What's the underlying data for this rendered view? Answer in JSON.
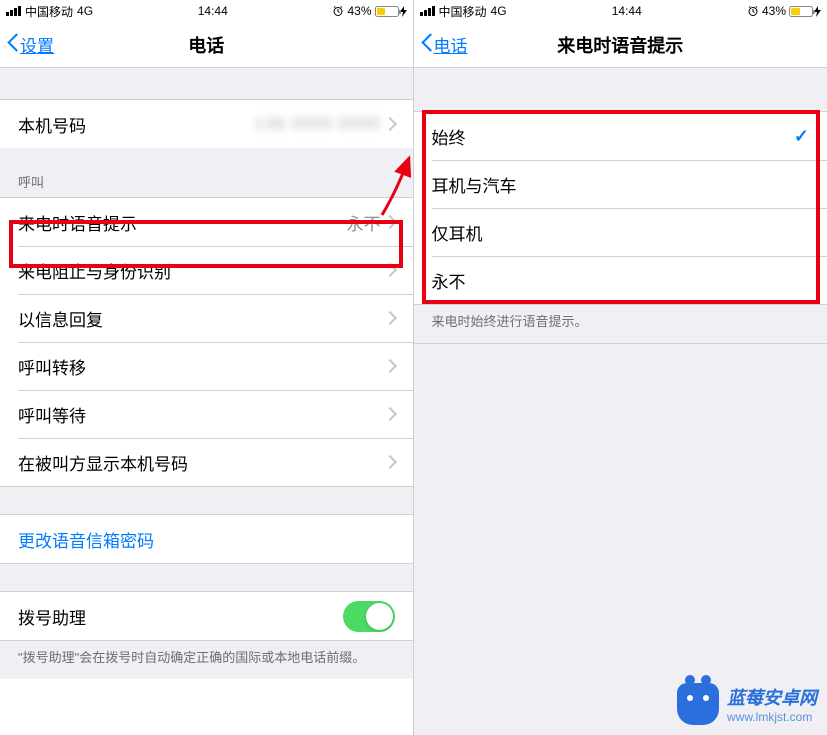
{
  "status": {
    "carrier": "中国移动",
    "network": "4G",
    "time": "14:44",
    "battery_pct": "43%"
  },
  "left": {
    "back_label": "设置",
    "title": "电话",
    "my_number_label": "本机号码",
    "my_number_value": "",
    "call_section_header": "呼叫",
    "announce_label": "来电时语音提示",
    "announce_value": "永不",
    "block_id_label": "来电阻止与身份识别",
    "respond_text_label": "以信息回复",
    "call_forward_label": "呼叫转移",
    "call_waiting_label": "呼叫等待",
    "show_caller_id_label": "在被叫方显示本机号码",
    "change_vm_pwd_label": "更改语音信箱密码",
    "dial_assist_label": "拨号助理",
    "dial_assist_footer": "\"拨号助理\"会在拨号时自动确定正确的国际或本地电话前缀。"
  },
  "right": {
    "back_label": "电话",
    "title": "来电时语音提示",
    "options": [
      {
        "label": "始终",
        "selected": true
      },
      {
        "label": "耳机与汽车",
        "selected": false
      },
      {
        "label": "仅耳机",
        "selected": false
      },
      {
        "label": "永不",
        "selected": false
      }
    ],
    "footer": "来电时始终进行语音提示。"
  },
  "watermark": {
    "title": "蓝莓安卓网",
    "url": "www.lmkjst.com"
  },
  "colors": {
    "ios_blue": "#007aff",
    "highlight_red": "#e60012",
    "toggle_green": "#4cd964",
    "battery_yellow": "#ffcc00"
  }
}
